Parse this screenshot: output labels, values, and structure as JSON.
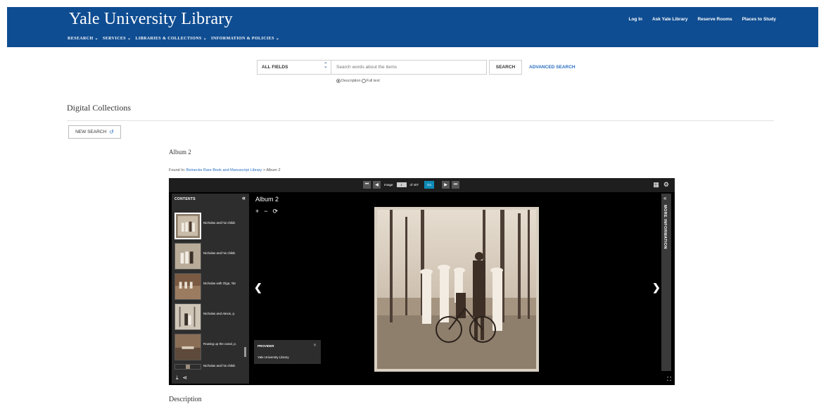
{
  "header": {
    "brand": "Yale University Library",
    "links": [
      "Log In",
      "Ask Yale Library",
      "Reserve Rooms",
      "Places to Study"
    ],
    "nav": [
      "RESEARCH",
      "SERVICES",
      "LIBRARIES & COLLECTIONS",
      "INFORMATION & POLICIES"
    ]
  },
  "search": {
    "field": "ALL FIELDS",
    "placeholder": "Search words about the items",
    "button": "SEARCH",
    "advanced": "ADVANCED SEARCH",
    "radio_description": "Description",
    "radio_fulltext": "Full text"
  },
  "page": {
    "section_title": "Digital Collections",
    "new_search": "NEW SEARCH",
    "item_title": "Album 2",
    "found_in_label": "Found In:",
    "found_in_link": "Beinecke Rare Book and Manuscript Library",
    "found_in_rest": " > Album 2",
    "description_heading": "Description"
  },
  "viewer": {
    "image_label": "Image",
    "image_number": "1",
    "image_total": "of 407",
    "go": "Go",
    "contents_label": "CONTENTS",
    "title": "Album 2",
    "thumbnails": [
      "Nicholas and his childr.",
      "Nicholas and his childr.",
      "Nicholas with Olga, Tat",
      "Nicholas and Alexis, p.",
      "Rowing up the canal, p.",
      "Nicholas and his childr."
    ],
    "provider_label": "PROVIDER",
    "provider_value": "Yale University Library",
    "more_info": "MORE INFORMATION"
  },
  "icons": {
    "first": "first-page-icon",
    "prev": "prev-page-icon",
    "next": "next-page-icon",
    "last": "last-page-icon",
    "grid": "grid-icon",
    "settings": "gear-icon",
    "download": "download-icon",
    "share": "share-icon",
    "fullscreen": "fullscreen-icon"
  },
  "colors": {
    "brand_blue": "#0f4d92",
    "link_blue": "#286dc0",
    "go_blue": "#0e8ab7"
  }
}
